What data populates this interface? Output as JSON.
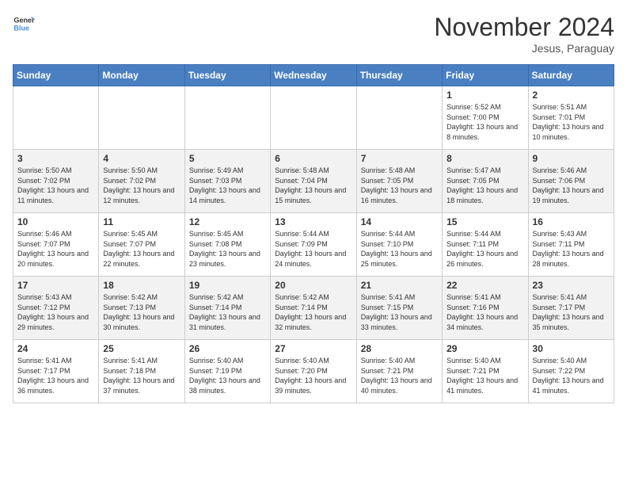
{
  "header": {
    "logo_line1": "General",
    "logo_line2": "Blue",
    "month_title": "November 2024",
    "location": "Jesus, Paraguay"
  },
  "days_of_week": [
    "Sunday",
    "Monday",
    "Tuesday",
    "Wednesday",
    "Thursday",
    "Friday",
    "Saturday"
  ],
  "weeks": [
    [
      {
        "day": "",
        "info": ""
      },
      {
        "day": "",
        "info": ""
      },
      {
        "day": "",
        "info": ""
      },
      {
        "day": "",
        "info": ""
      },
      {
        "day": "",
        "info": ""
      },
      {
        "day": "1",
        "info": "Sunrise: 5:52 AM\nSunset: 7:00 PM\nDaylight: 13 hours and 8 minutes."
      },
      {
        "day": "2",
        "info": "Sunrise: 5:51 AM\nSunset: 7:01 PM\nDaylight: 13 hours and 10 minutes."
      }
    ],
    [
      {
        "day": "3",
        "info": "Sunrise: 5:50 AM\nSunset: 7:02 PM\nDaylight: 13 hours and 11 minutes."
      },
      {
        "day": "4",
        "info": "Sunrise: 5:50 AM\nSunset: 7:02 PM\nDaylight: 13 hours and 12 minutes."
      },
      {
        "day": "5",
        "info": "Sunrise: 5:49 AM\nSunset: 7:03 PM\nDaylight: 13 hours and 14 minutes."
      },
      {
        "day": "6",
        "info": "Sunrise: 5:48 AM\nSunset: 7:04 PM\nDaylight: 13 hours and 15 minutes."
      },
      {
        "day": "7",
        "info": "Sunrise: 5:48 AM\nSunset: 7:05 PM\nDaylight: 13 hours and 16 minutes."
      },
      {
        "day": "8",
        "info": "Sunrise: 5:47 AM\nSunset: 7:05 PM\nDaylight: 13 hours and 18 minutes."
      },
      {
        "day": "9",
        "info": "Sunrise: 5:46 AM\nSunset: 7:06 PM\nDaylight: 13 hours and 19 minutes."
      }
    ],
    [
      {
        "day": "10",
        "info": "Sunrise: 5:46 AM\nSunset: 7:07 PM\nDaylight: 13 hours and 20 minutes."
      },
      {
        "day": "11",
        "info": "Sunrise: 5:45 AM\nSunset: 7:07 PM\nDaylight: 13 hours and 22 minutes."
      },
      {
        "day": "12",
        "info": "Sunrise: 5:45 AM\nSunset: 7:08 PM\nDaylight: 13 hours and 23 minutes."
      },
      {
        "day": "13",
        "info": "Sunrise: 5:44 AM\nSunset: 7:09 PM\nDaylight: 13 hours and 24 minutes."
      },
      {
        "day": "14",
        "info": "Sunrise: 5:44 AM\nSunset: 7:10 PM\nDaylight: 13 hours and 25 minutes."
      },
      {
        "day": "15",
        "info": "Sunrise: 5:44 AM\nSunset: 7:11 PM\nDaylight: 13 hours and 26 minutes."
      },
      {
        "day": "16",
        "info": "Sunrise: 5:43 AM\nSunset: 7:11 PM\nDaylight: 13 hours and 28 minutes."
      }
    ],
    [
      {
        "day": "17",
        "info": "Sunrise: 5:43 AM\nSunset: 7:12 PM\nDaylight: 13 hours and 29 minutes."
      },
      {
        "day": "18",
        "info": "Sunrise: 5:42 AM\nSunset: 7:13 PM\nDaylight: 13 hours and 30 minutes."
      },
      {
        "day": "19",
        "info": "Sunrise: 5:42 AM\nSunset: 7:14 PM\nDaylight: 13 hours and 31 minutes."
      },
      {
        "day": "20",
        "info": "Sunrise: 5:42 AM\nSunset: 7:14 PM\nDaylight: 13 hours and 32 minutes."
      },
      {
        "day": "21",
        "info": "Sunrise: 5:41 AM\nSunset: 7:15 PM\nDaylight: 13 hours and 33 minutes."
      },
      {
        "day": "22",
        "info": "Sunrise: 5:41 AM\nSunset: 7:16 PM\nDaylight: 13 hours and 34 minutes."
      },
      {
        "day": "23",
        "info": "Sunrise: 5:41 AM\nSunset: 7:17 PM\nDaylight: 13 hours and 35 minutes."
      }
    ],
    [
      {
        "day": "24",
        "info": "Sunrise: 5:41 AM\nSunset: 7:17 PM\nDaylight: 13 hours and 36 minutes."
      },
      {
        "day": "25",
        "info": "Sunrise: 5:41 AM\nSunset: 7:18 PM\nDaylight: 13 hours and 37 minutes."
      },
      {
        "day": "26",
        "info": "Sunrise: 5:40 AM\nSunset: 7:19 PM\nDaylight: 13 hours and 38 minutes."
      },
      {
        "day": "27",
        "info": "Sunrise: 5:40 AM\nSunset: 7:20 PM\nDaylight: 13 hours and 39 minutes."
      },
      {
        "day": "28",
        "info": "Sunrise: 5:40 AM\nSunset: 7:21 PM\nDaylight: 13 hours and 40 minutes."
      },
      {
        "day": "29",
        "info": "Sunrise: 5:40 AM\nSunset: 7:21 PM\nDaylight: 13 hours and 41 minutes."
      },
      {
        "day": "30",
        "info": "Sunrise: 5:40 AM\nSunset: 7:22 PM\nDaylight: 13 hours and 41 minutes."
      }
    ]
  ]
}
